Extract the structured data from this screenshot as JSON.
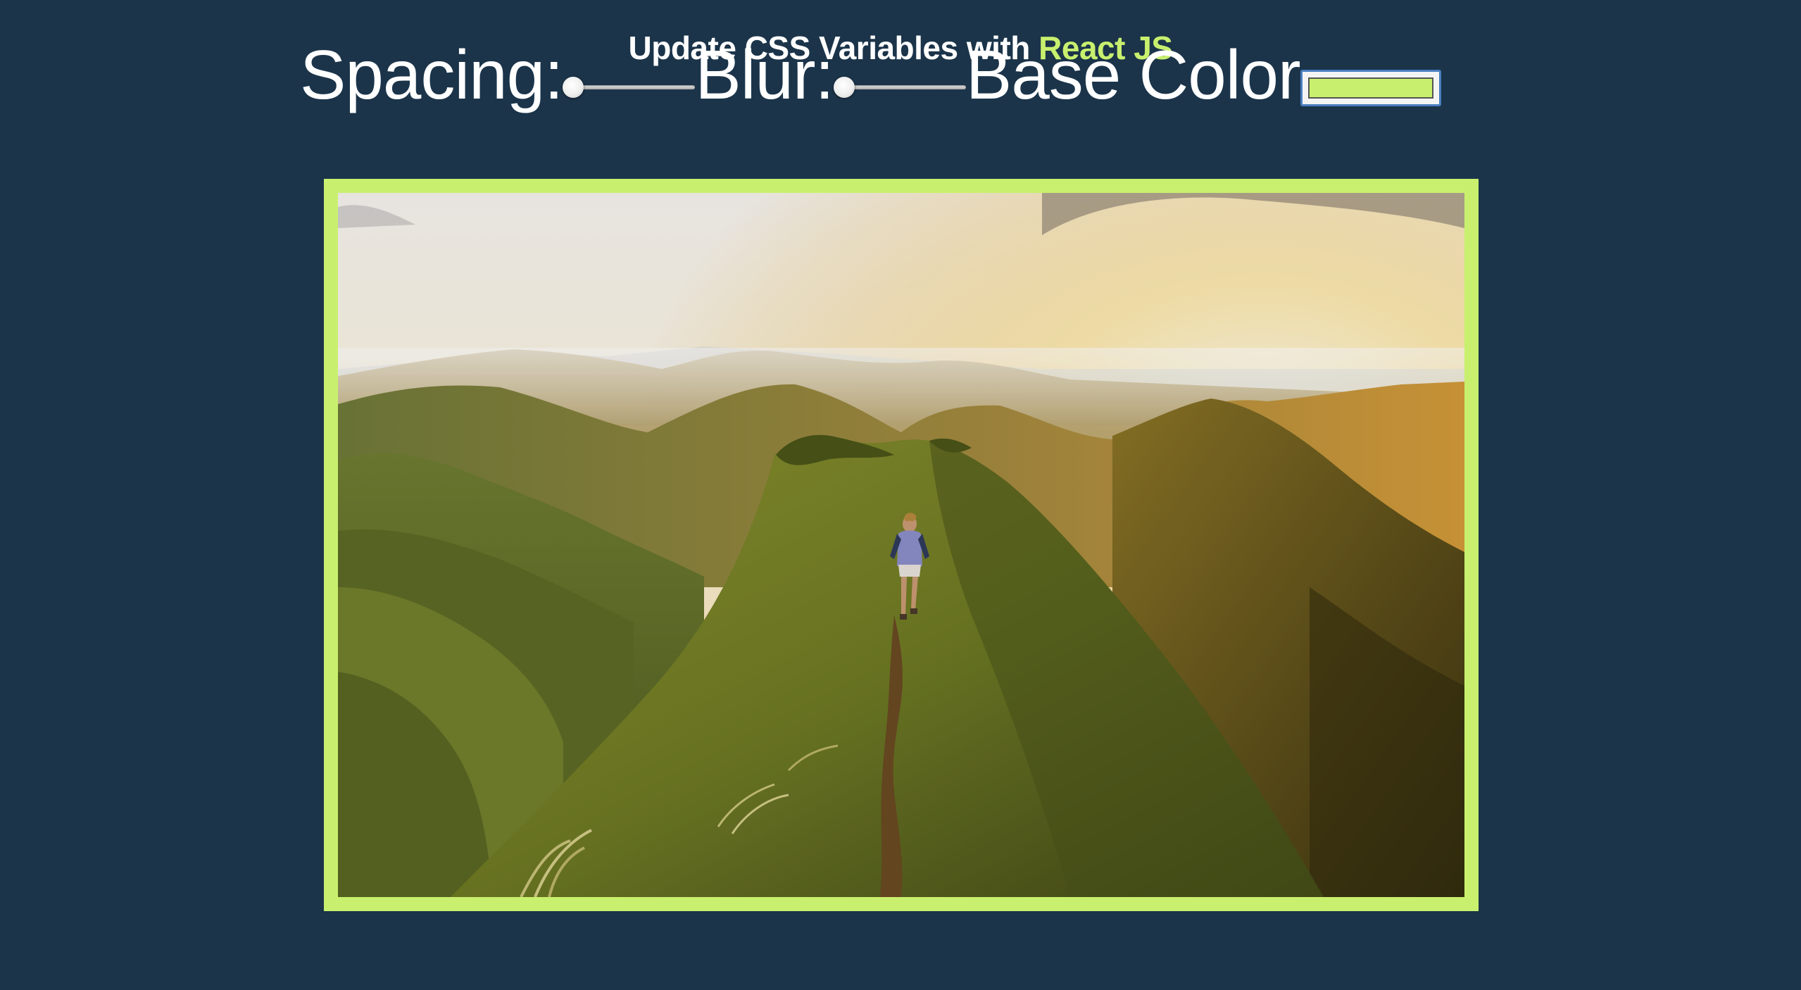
{
  "heading": {
    "text": "Update CSS Variables with",
    "accent": "React JS"
  },
  "controls": {
    "spacing": {
      "label": "Spacing:",
      "value_fraction": 0.0
    },
    "blur": {
      "label": "Blur:",
      "value_fraction": 0.0
    },
    "base_color": {
      "label": "Base Color",
      "value": "#c8f06e"
    }
  },
  "image": {
    "subject": "hiker walking on a grassy mountain ridge trail at sunset",
    "border_color": "#c8f06e"
  },
  "colors": {
    "background": "#1b344a",
    "accent": "#c8f06e",
    "text": "#ffffff"
  }
}
